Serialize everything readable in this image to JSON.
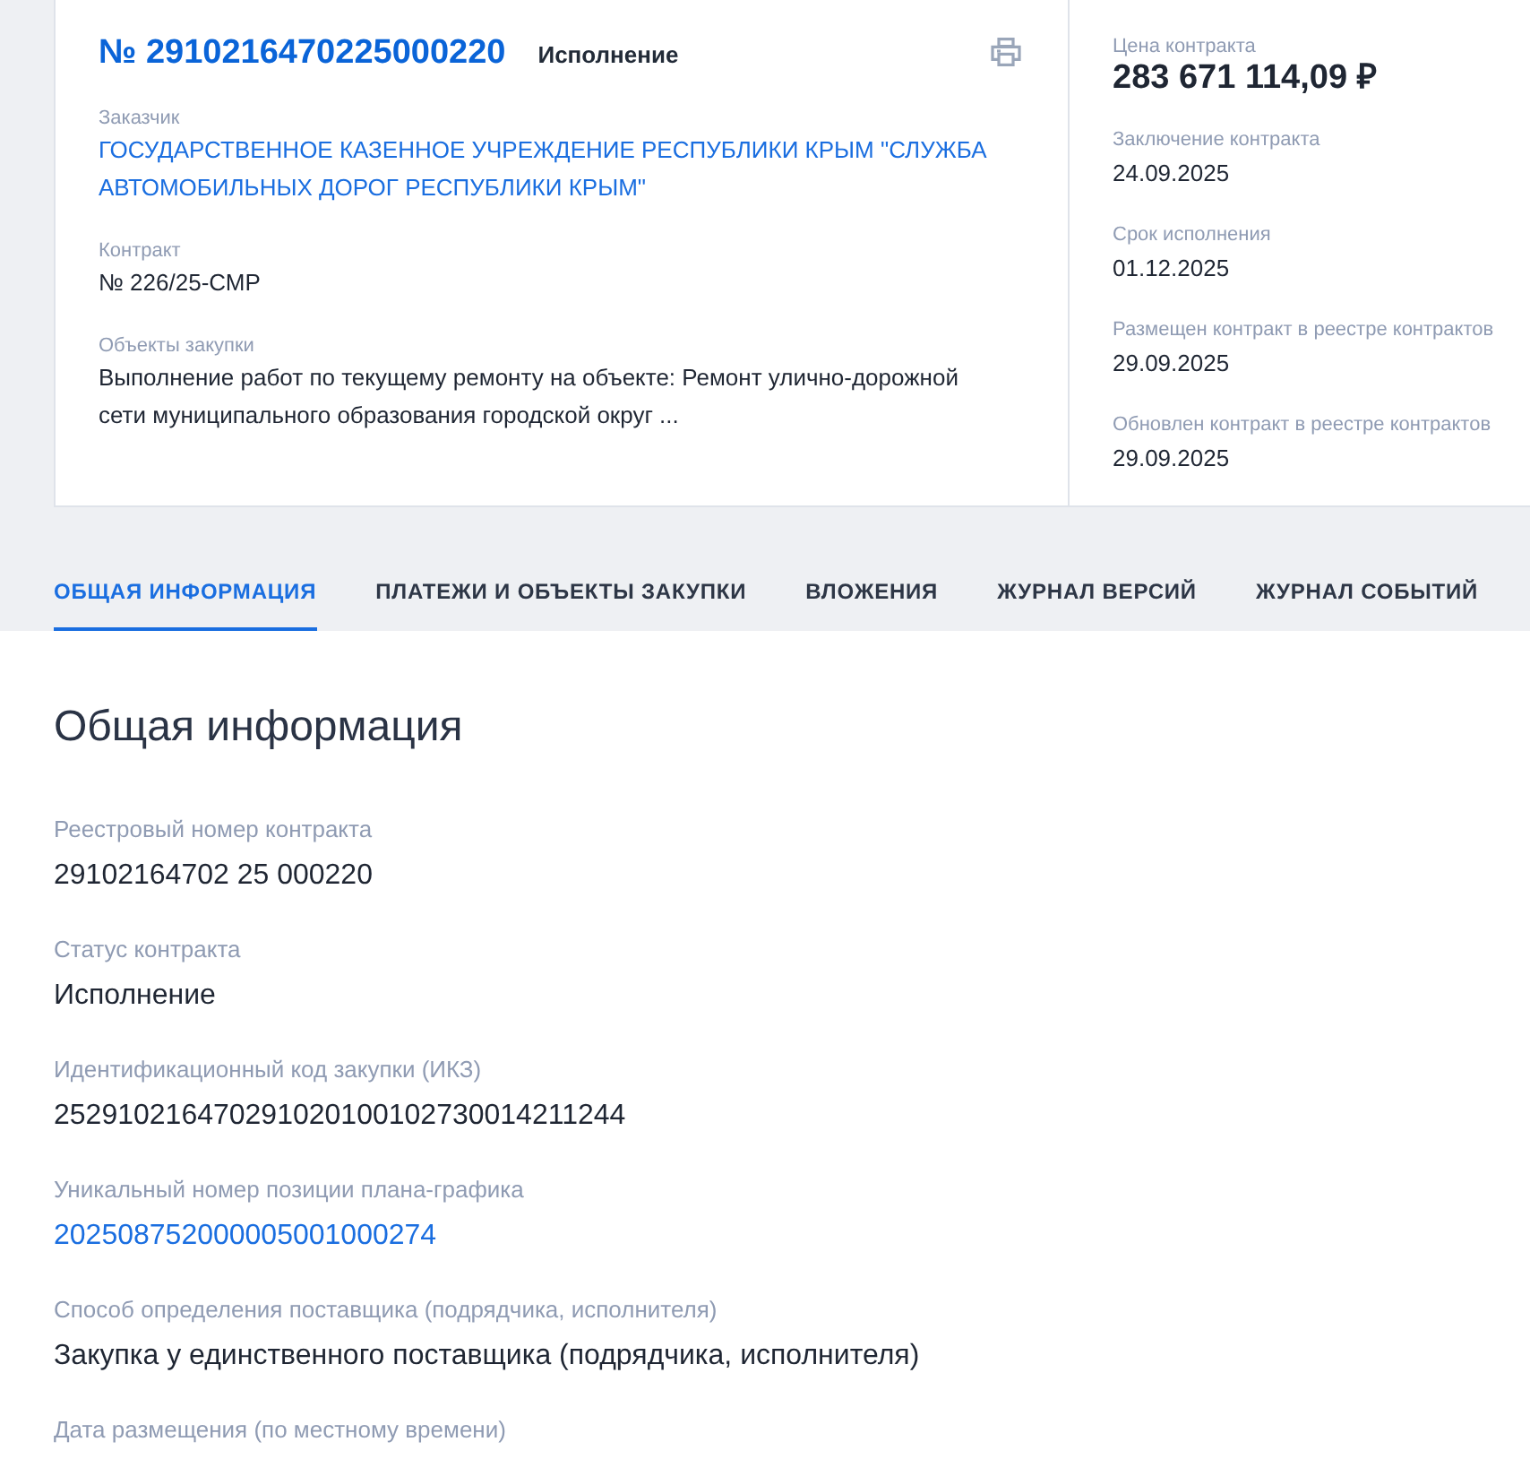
{
  "card": {
    "number": "№ 2910216470225000220",
    "status": "Исполнение",
    "fields": [
      {
        "label": "Заказчик",
        "value": "ГОСУДАРСТВЕННОЕ КАЗЕННОЕ УЧРЕЖДЕНИЕ РЕСПУБЛИКИ КРЫМ \"СЛУЖБА АВТОМОБИЛЬНЫХ ДОРОГ РЕСПУБЛИКИ КРЫМ\"",
        "link": true
      },
      {
        "label": "Контракт",
        "value": "№ 226/25-СМР",
        "link": false
      },
      {
        "label": "Объекты закупки",
        "value": "Выполнение работ по текущему ремонту на объекте: Ремонт улично-дорожной сети муниципального образования городской округ ...",
        "link": false
      }
    ],
    "side": [
      {
        "label": "Цена контракта",
        "value": "283 671 114,09 ₽",
        "kind": "price"
      },
      {
        "label": "Заключение контракта",
        "value": "24.09.2025",
        "kind": "date"
      },
      {
        "label": "Срок исполнения",
        "value": "01.12.2025",
        "kind": "date"
      },
      {
        "label": "Размещен контракт в реестре контрактов",
        "value": "29.09.2025",
        "kind": "date"
      },
      {
        "label": "Обновлен контракт в реестре контрактов",
        "value": "29.09.2025",
        "kind": "date"
      }
    ]
  },
  "tabs": [
    {
      "label": "ОБЩАЯ ИНФОРМАЦИЯ",
      "selected": true
    },
    {
      "label": "ПЛАТЕЖИ И ОБЪЕКТЫ ЗАКУПКИ",
      "selected": false
    },
    {
      "label": "ВЛОЖЕНИЯ",
      "selected": false
    },
    {
      "label": "ЖУРНАЛ ВЕРСИЙ",
      "selected": false
    },
    {
      "label": "ЖУРНАЛ СОБЫТИЙ",
      "selected": false
    }
  ],
  "section": {
    "title": "Общая информация",
    "fields": [
      {
        "label": "Реестровый номер контракта",
        "value": "29102164702 25 000220",
        "link": false
      },
      {
        "label": "Статус контракта",
        "value": "Исполнение",
        "link": false
      },
      {
        "label": "Идентификационный код закупки (ИКЗ)",
        "value": "252910216470291020100102730014211244",
        "link": false
      },
      {
        "label": "Уникальный номер позиции плана-графика",
        "value": "202508752000005001000274",
        "link": true
      },
      {
        "label": "Способ определения поставщика (подрядчика, исполнителя)",
        "value": "Закупка у единственного поставщика (подрядчика, исполнителя)",
        "link": false
      },
      {
        "label": "Дата размещения (по местному времени)"
      }
    ]
  }
}
